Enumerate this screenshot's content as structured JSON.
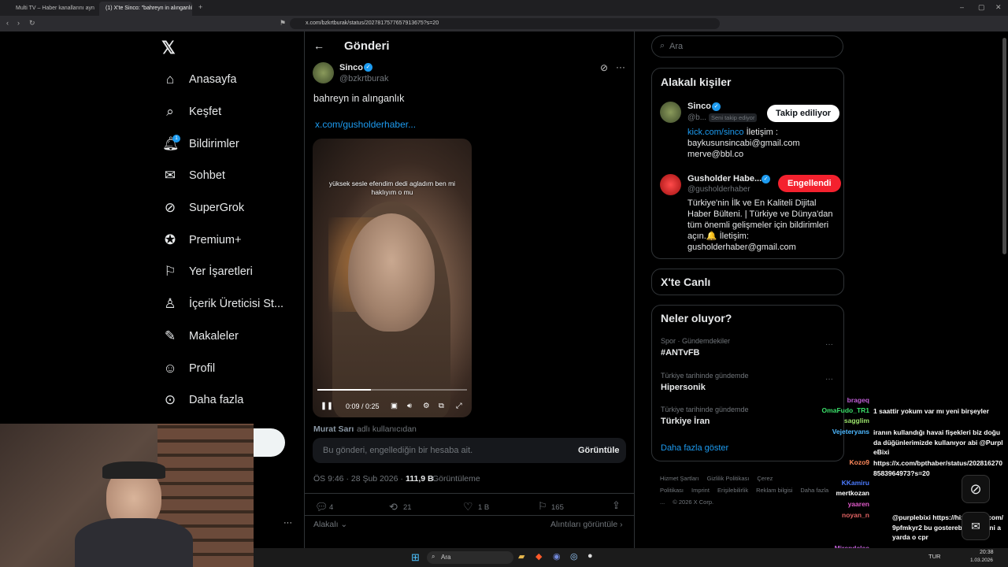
{
  "browser": {
    "tabs": [
      "Multi TV – Haber kanallarını aynı anda izle",
      "(1) X'te Sinco: \"bahreyn in alınganlık\""
    ],
    "url": "x.com/bzkrtburak/status/2027817577657913675?s=20"
  },
  "nav": {
    "items": [
      {
        "label": "Anasayfa",
        "icon": "home-icon"
      },
      {
        "label": "Keşfet",
        "icon": "search-icon"
      },
      {
        "label": "Bildirimler",
        "icon": "bell-icon"
      },
      {
        "label": "Sohbet",
        "icon": "mail-icon"
      },
      {
        "label": "SuperGrok",
        "icon": "grok-icon"
      },
      {
        "label": "Premium+",
        "icon": "verified-icon"
      },
      {
        "label": "Yer İşaretleri",
        "icon": "bookmark-icon"
      },
      {
        "label": "İçerik Üreticisi St...",
        "icon": "creator-icon"
      },
      {
        "label": "Makaleler",
        "icon": "article-icon"
      },
      {
        "label": "Profil",
        "icon": "person-icon"
      },
      {
        "label": "Daha fazla",
        "icon": "more-circle-icon"
      }
    ],
    "notif_badge": "1"
  },
  "post": {
    "header": "Gönderi",
    "author_name": "Sinco",
    "author_handle": "@bzkrtburak",
    "text": "bahreyn in alınganlık",
    "link": "x.com/gusholderhaber...",
    "video": {
      "caption": "yüksek sesle efendim dedi agladım ben mi haklıyım o mu",
      "time": "0:09 / 0:25",
      "progress": 0.36
    },
    "credit_name": "Murat Sarı",
    "credit_suffix": "adlı kullanıcıdan",
    "blocked_notice": "Bu gönderi, engellediğin bir hesaba ait.",
    "blocked_action": "Görüntüle",
    "meta_time": "ÖS 9:46 · 28 Şub 2026 ·",
    "meta_views": "111,9 B",
    "meta_views_label": "Görüntüleme",
    "stats": {
      "replies": "4",
      "reposts": "21",
      "likes": "1 B",
      "bookmarks": "165"
    },
    "related_label": "Alakalı",
    "quotes_label": "Alıntıları görüntüle"
  },
  "sidebar": {
    "search_placeholder": "Ara",
    "related_title": "Alakalı kişiler",
    "people": [
      {
        "name": "Sinco",
        "handle": "@b...",
        "follows_you": "Seni takip ediyor",
        "button": "Takip ediliyor",
        "bio_link": "kick.com/sinco",
        "bio_rest": "İletişim : baykusunsincabi@gmail.com merve@bbl.co"
      },
      {
        "name": "Gusholder Habe...",
        "handle": "@gusholderhaber",
        "button": "Engellendi",
        "bio": "Türkiye'nin İlk ve En Kaliteli Dijital Haber Bülteni. | Türkiye ve Dünya'dan tüm önemli gelişmeler için bildirimleri açın.🔔 İletişim: gusholderhaber@gmail.com"
      }
    ],
    "live_title": "X'te Canlı",
    "trends_title": "Neler oluyor?",
    "trends": [
      {
        "context": "Spor · Gündemdekiler",
        "name": "#ANTvFB"
      },
      {
        "context": "Türkiye tarihinde gündemde",
        "name": "Hipersonik"
      },
      {
        "context": "Türkiye tarihinde gündemde",
        "name": "Türkiye İran"
      }
    ],
    "show_more": "Daha fazla göster",
    "footer_links": [
      "Hizmet Şartları",
      "Gizlilik Politikası",
      "Çerez Politikası",
      "Imprint",
      "Erişilebilirlik",
      "Reklam bilgisi",
      "Daha fazla ...",
      "© 2026 X Corp."
    ]
  },
  "chat": [
    {
      "user": "brageq",
      "msg": "",
      "color": "#c05fd6"
    },
    {
      "user": "OmaFudo_TR1",
      "msg": "1 saattir yokum var mı yeni birşeyler",
      "color": "#3be06a"
    },
    {
      "user": "sagglim",
      "msg": "",
      "color": "#9be36c"
    },
    {
      "user": "Vejeteryans",
      "msg": "iranın kullandığı havai fişekleri biz doğuda düğünlerimizde kullanıyor abi @PurpleBixi",
      "color": "#4db8ff"
    },
    {
      "user": "Kozo9",
      "msg": "https://x.com/bpthaber/status/2028162708583964973?s=20",
      "color": "#ff8a5c"
    },
    {
      "user": "KKamiru",
      "msg": "",
      "color": "#4b7bff"
    },
    {
      "user": "mertkozan",
      "msg": "",
      "color": "#ffffff"
    },
    {
      "user": "yaaren",
      "msg": "",
      "color": "#e05ac9"
    },
    {
      "user": "noyan_n",
      "msg": "@purplebixi https://hizliresim.com/9pfmkyr2 bu gosterebilirsin ayni ayarda o cpr",
      "color": "#e06262"
    },
    {
      "user": "Mirendalee",
      "msg": "",
      "color": "#c05fd6"
    }
  ],
  "taskbar": {
    "search": "Ara",
    "lang": "TUR",
    "time": "20:38",
    "date": "1.03.2026"
  }
}
